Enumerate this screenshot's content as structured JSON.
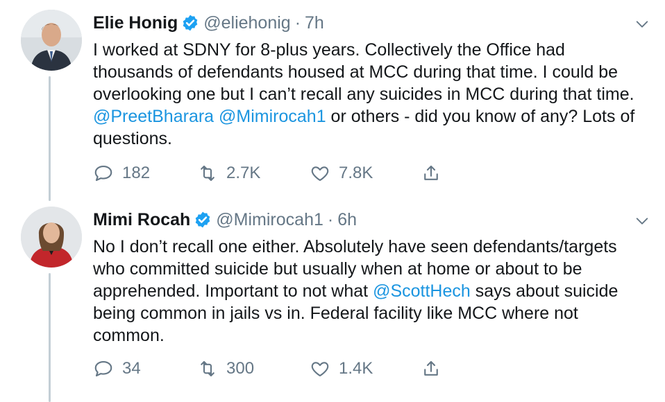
{
  "tweets": [
    {
      "name": "Elie Honig",
      "handle": "@eliehonig",
      "separator": "·",
      "time": "7h",
      "text_parts": [
        "I worked at SDNY for 8-plus years. Collectively the Office had thousands of defendants housed at MCC during that time. I could be overlooking one but I can’t recall any suicides in MCC during that time. ",
        "@PreetBharara",
        " ",
        "@Mimirocah1",
        " or others - did you know of any? Lots of questions."
      ],
      "replies": "182",
      "retweets": "2.7K",
      "likes": "7.8K"
    },
    {
      "name": "Mimi Rocah",
      "handle": "@Mimirocah1",
      "separator": "·",
      "time": "6h",
      "text_parts": [
        "No I don’t recall one either. Absolutely have seen defendants/targets who committed suicide but usually when at home or about to be apprehended. Important to not what ",
        "@ScottHech",
        " says about suicide being common in jails vs in. Federal facility like MCC where not common."
      ],
      "replies": "34",
      "retweets": "300",
      "likes": "1.4K"
    }
  ],
  "colors": {
    "text": "#14171a",
    "secondary": "#657786",
    "link": "#1b95e0",
    "verified": "#1da1f2",
    "thread_line": "#c4cfd6"
  },
  "icons": [
    "verified-badge-icon",
    "chevron-down-icon",
    "reply-icon",
    "retweet-icon",
    "like-icon",
    "share-icon"
  ]
}
